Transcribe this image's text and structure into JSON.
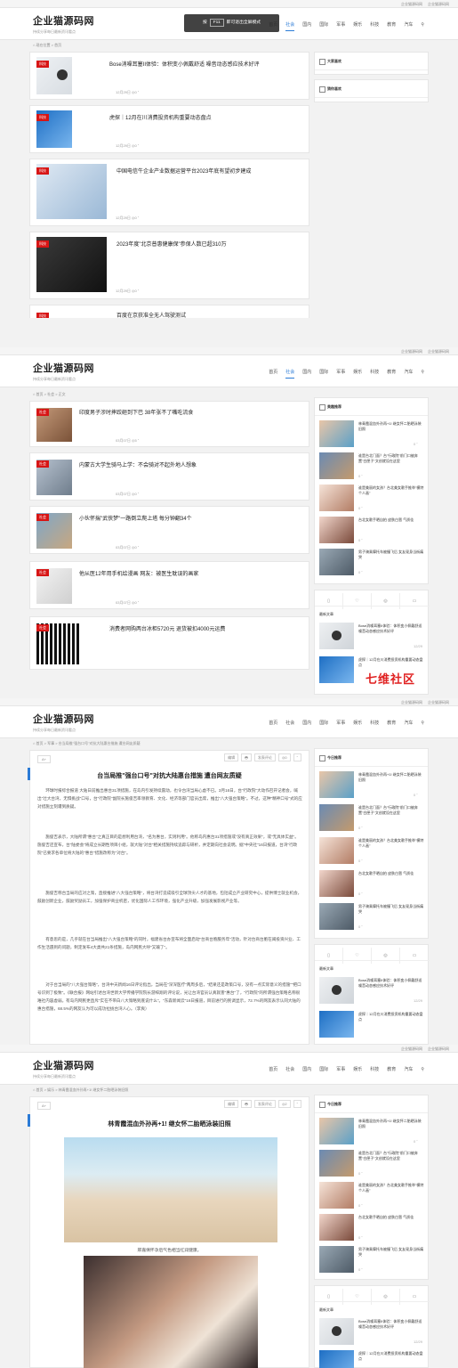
{
  "topbar": {
    "link1": "企业猫源码网",
    "link2": "企业猫源码网"
  },
  "site": {
    "title": "企业猫源码网",
    "subtitle": "持续分享每日最新资讯看点"
  },
  "nav": [
    "首页",
    "社会",
    "国内",
    "国际",
    "军事",
    "娱乐",
    "科技",
    "教育",
    "汽车"
  ],
  "fullscreen_toast": {
    "prefix": "按",
    "key": "F11",
    "suffix": "即可退出全屏模式"
  },
  "watermark": "七维社区",
  "panel1": {
    "breadcrumb": "⌂ 现在位置 > 首页",
    "cards": [
      {
        "tag": "科技",
        "title": "Bose消噪耳塞II体验：体积变小佩戴舒适 噪音动态感应技术好评",
        "meta": "12月29日 ◎0 ˚"
      },
      {
        "tag": "科技",
        "title": "虎探｜12月在川消费投资机构重要动态盘点",
        "meta": "12月29日 ◎0 ˚"
      },
      {
        "tag": "科技",
        "title": "中国电信牛企业产业数据运营平台2023年底有望初步建成",
        "meta": "12月29日 ◎0 ˚"
      },
      {
        "tag": "科技",
        "title": "2023年度\"北京普惠健康保\"参保人数已超310万",
        "meta": "12月29日 ◎0 ˚"
      },
      {
        "tag": "科技",
        "title": "百度在京获准全无人驾驶测试",
        "meta": ""
      }
    ],
    "side": [
      {
        "heading": "大家喜欢"
      },
      {
        "heading": "猜你喜欢"
      }
    ]
  },
  "panel2": {
    "breadcrumb": "⌂ 首页 > 社会 > 正文",
    "cards": [
      {
        "tag": "社会",
        "title": "印度男子涉时摔跤砸到下巴 38年张不了嘴吃流食",
        "meta": "03月07日 ◎5 ˚"
      },
      {
        "tag": "社会",
        "title": "内蒙古大学生骑马上学：不会骑对不起外地人想象",
        "meta": "03月07日 ◎0 ˚"
      },
      {
        "tag": "社会",
        "title": "小伙怀揣\"武侠梦\"一路倒立爬上塔 每分钟翻34个",
        "meta": "03月07日 ◎0 ˚"
      },
      {
        "tag": "社会",
        "title": "他从医12年用手机绘漫画 网友：被医生耽误的画家",
        "meta": "03月07日 ◎0 ˚"
      },
      {
        "tag": "社会",
        "title": "消费者网购两台冰柜5720元 退货被扣4000元运费",
        "meta": ""
      }
    ],
    "side_heading": "美趣推荐",
    "side_items": [
      {
        "title": "林青霞混血外孙再+1! 继女怀二胎晒泳装旧照",
        "meta": "0 ˚"
      },
      {
        "title": "谁是台北门面？台\"行政院\"前门口被弃置\"白匣子\"文创就设在这里",
        "meta": "0 ˚"
      },
      {
        "title": "谁是美丽的女孩？台北美女歌手推举\"模特个人画\"",
        "meta": "0 ˚"
      },
      {
        "title": "台北女歌手晒自拍 皮肤白皙 气质佳",
        "meta": "0 ˚"
      },
      {
        "title": "男子骑乘摩托车被撞飞后 女友现身当街痛哭",
        "meta": "0 ˚"
      }
    ],
    "tabs": [
      "▯",
      "♡",
      "◎",
      "▭"
    ],
    "latest_heading": "最新文章",
    "latest": [
      {
        "title": "Bose消噪耳塞II体验：体积变小佩戴舒适 噪音动态感应技术好评",
        "meta": "12/29"
      },
      {
        "title": "虎探｜12月在川消费投资机构重要动态盘点",
        "meta": "12/29"
      }
    ]
  },
  "panel3": {
    "breadcrumb": "⌂ 首页 > 军事 > 台当局推\"强台口号\"对抗大陆惠台措施 遭台网友质疑",
    "tools": {
      "font": "A+",
      "btn1": "编辑",
      "btn2": "🖶",
      "btn3": "发表评论",
      "btn4": "◎0",
      "btn5": "˚"
    },
    "title": "台当局推\"强台口号\"对抗大陆惠台措施 遭台网友质疑",
    "paras": [
      "环球时报综合报道 大陆日前推出惠台31项措施，在岛内引发持续震动，也令台湾当局心虚不已。3月16日，台\"行政院\"大动作召开记者会，喊出\"壮大台湾，无惧挑战\"口号，台\"行政院\"副院长施俊吉率领教育、文化、经济等部门官员出席，推出\"八大强台策略\"。不过，这种\"精神口号\"式的应对措施立刻遭到质疑。",
      "施俊吉表示，大陆所谓\"惠台\"之真正目的是想利用台湾，\"名为惠台，实则利用\"。他称岛内惠台31项措施或\"没有真正效果\"，或\"无具体实益\"。施俊吉还宣布，台\"陆委会\"将成立长期性项目小组，就大陆\"对台\"相关措施持续追踪与研析，并定期向社会说明。据\"中央社\"16日报道，台湾\"行政院\"已要求各单位将大陆的\"惠台\"措施改称为\"对台\"。",
      "施俊吉称台当局的应对之策，直接推进\"八大强台策略\"，将台湾打造成吸引全球顶尖人才的基地，包括成立产业研究中心，提供博士就业机会，鼓励创新企业，鼓励奖励员工，加强保护商业机密，优化国际人工作环境，强化产业升级，加强发展影视产业等。",
      "有意思的是，几乎就在台当局推出\"八大强台策略\"的同时，福建省台办宣布将全面启动\"台商台胞服务年\"活动，针对台商台胞在闽投资兴业、工作生活遇到的问题，制定发布4大类共21条措施，岛内网民大呼\"又输了\"。",
      "对于台当局的\"八大强台策略\"，台湾中天新闻16日评论指出，当局在\"深深医疗\"两周多后，\"结果还是政策口号，没有一点实际意义的措施\"\"把口号识到了极致\"。《联合报》网站引述台湾世新大学传播学院院长游梓翔的评论说，光让台湾官员认真就害\"惠台\"了，\"行政院\"的所谓强台策略名称很难社内容虚弱。有岛内网民更直斥\"实在不带白八大策略到底说什么\"。\"东森新闻云\"16日报道，目前进行的民调显示，72.7%的网友表示认同大陆的惠台措施，68.5%的网友认为可以成功拉拢台湾人心。（李爽）"
    ],
    "side_heading": "今日推荐",
    "side_items": [
      {
        "title": "林青霞混血外孙再+1! 继女怀二胎晒泳装旧照",
        "meta": "0 ˚"
      },
      {
        "title": "谁是台北门面？台\"行政院\"前门口被弃置\"白匣子\"文创就设在这里",
        "meta": "0 ˚"
      },
      {
        "title": "谁是美丽的女孩？台北美女歌手推举\"模特个人画\"",
        "meta": "0 ˚"
      },
      {
        "title": "台北女歌手晒自拍 皮肤白皙 气质佳",
        "meta": "0 ˚"
      },
      {
        "title": "男子骑乘摩托车被撞飞后 女友现身当街痛哭",
        "meta": "0 ˚"
      }
    ],
    "tabs": [
      "▯",
      "♡",
      "◎",
      "▭"
    ],
    "latest_heading": "最新文章",
    "latest": [
      {
        "title": "Bose消噪耳塞II体验：体积变小佩戴舒适 噪音动态感应技术好评",
        "meta": "12/29"
      },
      {
        "title": "虎探｜12月在川消费投资机构重要动态盘点",
        "meta": "12/29"
      }
    ]
  },
  "panel4": {
    "breadcrumb": "⌂ 首页 > 娱乐 > 林青霞混血外孙再+1! 继女怀二胎晒泳装旧照",
    "tools": {
      "font": "A+",
      "btn1": "编辑",
      "btn2": "🖶",
      "btn3": "发表评论",
      "btn4": "◎2",
      "btn5": "˚"
    },
    "title": "林青霞混血外孙再+1! 继女怀二胎晒泳装旧照",
    "caption": "邢嘉倩怀孕后气色相当红润健康。",
    "side_heading": "今日推荐",
    "side_items": [
      {
        "title": "林青霞混血外孙再+1! 继女怀二胎晒泳装旧照",
        "meta": "0 ˚"
      },
      {
        "title": "谁是台北门面？台\"行政院\"前门口被弃置\"白匣子\"文创就设在这里",
        "meta": "0 ˚"
      },
      {
        "title": "谁是美丽的女孩？台北美女歌手推举\"模特个人画\"",
        "meta": "0 ˚"
      },
      {
        "title": "台北女歌手晒自拍 皮肤白皙 气质佳",
        "meta": "0 ˚"
      },
      {
        "title": "男子骑乘摩托车被撞飞后 女友现身当街痛哭",
        "meta": "0 ˚"
      }
    ],
    "tabs": [
      "▯",
      "♡",
      "◎",
      "▭"
    ],
    "latest_heading": "最新文章",
    "latest": [
      {
        "title": "Bose消噪耳塞II体验：体积变小佩戴舒适 噪音动态感应技术好评",
        "meta": "12/29"
      },
      {
        "title": "虎探｜12月在川消费投资机构重要动态盘点",
        "meta": "12/29"
      }
    ]
  }
}
